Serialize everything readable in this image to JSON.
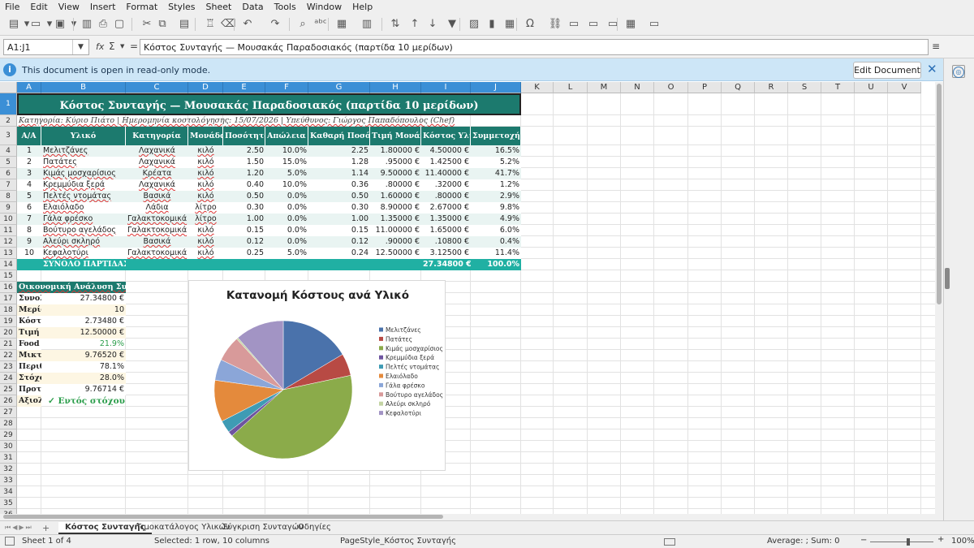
{
  "menu": [
    "File",
    "Edit",
    "View",
    "Insert",
    "Format",
    "Styles",
    "Sheet",
    "Data",
    "Tools",
    "Window",
    "Help"
  ],
  "namebox": "A1:J1",
  "formula_icons": {
    "fx": "fx",
    "sum": "Σ",
    "eq": "="
  },
  "formula": "Κόστος Συνταγής — Μουσακάς Παραδοσιακός (παρτίδα 10 μερίδων)",
  "infobar": {
    "text": "This document is open in read-only mode.",
    "button": "Edit Document"
  },
  "columns": [
    "A",
    "B",
    "C",
    "D",
    "E",
    "F",
    "G",
    "H",
    "I",
    "J",
    "K",
    "L",
    "M",
    "N",
    "O",
    "P",
    "Q",
    "R",
    "S",
    "T",
    "U",
    "V"
  ],
  "rows": [
    "1",
    "2",
    "3",
    "4",
    "5",
    "6",
    "7",
    "8",
    "9",
    "10",
    "11",
    "12",
    "13",
    "14",
    "15",
    "16",
    "17",
    "18",
    "19",
    "20",
    "21",
    "22",
    "23",
    "24",
    "25",
    "26",
    "27",
    "28",
    "29",
    "30",
    "31",
    "32",
    "33",
    "34",
    "35",
    "36"
  ],
  "sheet": {
    "title": "Κόστος Συνταγής — Μουσακάς Παραδοσιακός (παρτίδα 10 μερίδων)",
    "meta": "Κατηγορία: Κύριο Πιάτο  |  Ημερομηνία κοστολόγησης: 15/07/2026  |  Υπεύθυνος: Γιώργος Παπαδόπουλος (Chef)",
    "headers": [
      "Α/Α",
      "Υλικό",
      "Κατηγορία",
      "Μονάδα",
      "Ποσότητα",
      "Απώλεια %",
      "Καθαρή Ποσότητα",
      "Τιμή Μονάδας",
      "Κόστος Υλικού",
      "Συμμετοχή %"
    ],
    "items": [
      [
        "1",
        "Μελιτζάνες",
        "Λαχανικά",
        "κιλό",
        "2.50",
        "10.0%",
        "2.25",
        "1.80000 €",
        "4.50000 €",
        "16.5%"
      ],
      [
        "2",
        "Πατάτες",
        "Λαχανικά",
        "κιλό",
        "1.50",
        "15.0%",
        "1.28",
        ".95000 €",
        "1.42500 €",
        "5.2%"
      ],
      [
        "3",
        "Κιμάς μοσχαρίσιος",
        "Κρέατα",
        "κιλό",
        "1.20",
        "5.0%",
        "1.14",
        "9.50000 €",
        "11.40000 €",
        "41.7%"
      ],
      [
        "4",
        "Κρεμμύδια ξερά",
        "Λαχανικά",
        "κιλό",
        "0.40",
        "10.0%",
        "0.36",
        ".80000 €",
        ".32000 €",
        "1.2%"
      ],
      [
        "5",
        "Πελτές ντομάτας",
        "Βασικά",
        "κιλό",
        "0.50",
        "0.0%",
        "0.50",
        "1.60000 €",
        ".80000 €",
        "2.9%"
      ],
      [
        "6",
        "Ελαιόλαδο",
        "Λάδια",
        "λίτρο",
        "0.30",
        "0.0%",
        "0.30",
        "8.90000 €",
        "2.67000 €",
        "9.8%"
      ],
      [
        "7",
        "Γάλα φρέσκο",
        "Γαλακτοκομικά",
        "λίτρο",
        "1.00",
        "0.0%",
        "1.00",
        "1.35000 €",
        "1.35000 €",
        "4.9%"
      ],
      [
        "8",
        "Βούτυρο αγελάδος",
        "Γαλακτοκομικά",
        "κιλό",
        "0.15",
        "0.0%",
        "0.15",
        "11.00000 €",
        "1.65000 €",
        "6.0%"
      ],
      [
        "9",
        "Αλεύρι σκληρό",
        "Βασικά",
        "κιλό",
        "0.12",
        "0.0%",
        "0.12",
        ".90000 €",
        ".10800 €",
        "0.4%"
      ],
      [
        "10",
        "Κεφαλοτύρι",
        "Γαλακτοκομικά",
        "κιλό",
        "0.25",
        "5.0%",
        "0.24",
        "12.50000 €",
        "3.12500 €",
        "11.4%"
      ]
    ],
    "total": {
      "label": "ΣΥΝΟΛΟ ΠΑΡΤΙΔΑΣ",
      "cost": "27.34800 €",
      "share": "100.0%"
    },
    "analysis_title": "Οικονομική Ανάλυση Συνταγής",
    "analysis": [
      {
        "label": "Συνολικό",
        "value": "27.34800 €"
      },
      {
        "label": "Μερίδες",
        "value": "10"
      },
      {
        "label": "Κόστος μερίδας",
        "value": "2.73480 €"
      },
      {
        "label": "Τιμή πώλησης",
        "value": "12.50000 €"
      },
      {
        "label": "Food cost",
        "value": "21.9%"
      },
      {
        "label": "Μικτό κέρδος",
        "value": "9.76520 €"
      },
      {
        "label": "Περιθώριο",
        "value": "78.1%"
      },
      {
        "label": "Στόχος",
        "value": "28.0%"
      },
      {
        "label": "Προτεινόμενη",
        "value": "9.76714 €"
      },
      {
        "label": "Αξιολόγηση",
        "value": "✓ Εντός στόχου"
      }
    ]
  },
  "chart_data": {
    "type": "pie",
    "title": "Κατανομή Κόστους ανά Υλικό",
    "categories": [
      "Μελιτζάνες",
      "Πατάτες",
      "Κιμάς μοσχαρίσιος",
      "Κρεμμύδια ξερά",
      "Πελτές ντομάτας",
      "Ελαιόλαδο",
      "Γάλα φρέσκο",
      "Βούτυρο αγελάδος",
      "Αλεύρι σκληρό",
      "Κεφαλοτύρι"
    ],
    "values": [
      4.5,
      1.425,
      11.4,
      0.32,
      0.8,
      2.67,
      1.35,
      1.65,
      0.108,
      3.125
    ],
    "colors": [
      "#4a72ab",
      "#b84a44",
      "#8bab4a",
      "#6e54a0",
      "#3e9bb4",
      "#e48a3c",
      "#8ba6d8",
      "#d89a9a",
      "#c4d4a4",
      "#a294c4"
    ],
    "legend": "right"
  },
  "tabs": [
    "Κόστος Συνταγής",
    "Τιμοκατάλογος Υλικών",
    "Σύγκριση Συνταγών",
    "Οδηγίες"
  ],
  "status": {
    "sheet": "Sheet 1 of 4",
    "selection": "Selected: 1 row, 10 columns",
    "style": "PageStyle_Κόστος Συνταγής",
    "summary": "Average: ; Sum: 0",
    "zoom": "100%"
  },
  "colors": {
    "teal": "#1c7a6e",
    "total": "#20b0a3",
    "selection": "#3b8fd6"
  }
}
